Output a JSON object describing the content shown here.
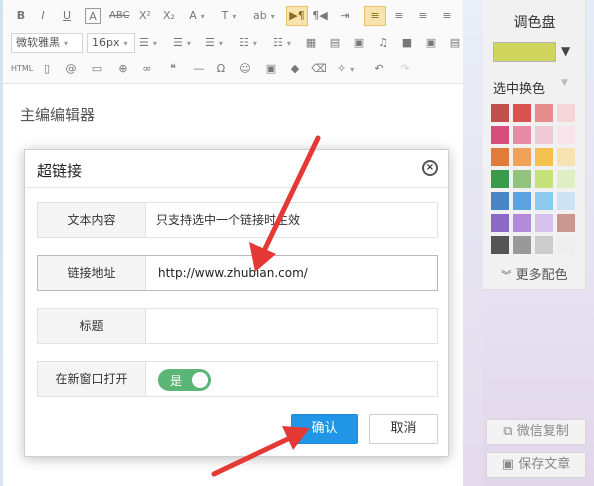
{
  "toolbar": {
    "font_family": "微软雅黑",
    "font_size": "16px",
    "html_label": "HTML"
  },
  "editor": {
    "placeholder": "主编编辑器"
  },
  "palette": {
    "title": "调色盘",
    "current_color": "#cfd45c",
    "picker_label": "选中换色",
    "more_colors": "更多配色",
    "swatches": [
      "#c0504d",
      "#d9534f",
      "#e78c8c",
      "#f5d5d5",
      "#d64f7c",
      "#e78aa8",
      "#f0c9d6",
      "#f7e4ea",
      "#e07b39",
      "#f0a15a",
      "#f5c04e",
      "#f7e2b0",
      "#3a9a4c",
      "#93c47d",
      "#c6e07a",
      "#e0eec6",
      "#4a86c5",
      "#5ba4e0",
      "#8ccbee",
      "#cce3f3",
      "#8e6ac8",
      "#b28ad9",
      "#d6c0ee",
      "#c8978f",
      "#555555",
      "#999999",
      "#cccccc",
      "#eeeeee"
    ]
  },
  "side_buttons": {
    "copy_wechat": "微信复制",
    "save_article": "保存文章"
  },
  "dialog": {
    "title": "超链接",
    "rows": {
      "text_label": "文本内容",
      "text_value": "只支持选中一个链接时生效",
      "url_label": "链接地址",
      "url_value": "http://www.zhubian.com/",
      "title_label": "标题",
      "title_value": "",
      "new_window_label": "在新窗口打开",
      "new_window_toggle": "是"
    },
    "confirm": "确认",
    "cancel": "取消"
  },
  "colors": {
    "accent_blue": "#2196e6",
    "toggle_green": "#5ab576",
    "arrow_red": "#e53935"
  }
}
